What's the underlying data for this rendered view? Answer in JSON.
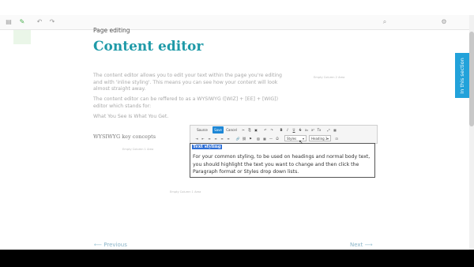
{
  "topbar": {
    "icons": [
      "page-icon",
      "edit-icon",
      "undo-icon",
      "redo-icon",
      "search-icon",
      "settings-icon"
    ]
  },
  "page": {
    "subtitle": "Page editing",
    "title": "Content editor",
    "paragraphs": [
      "The content editor allows you to edit your text within the page you're editing and with 'inline styling'. This means you can see how your content will look almost straight away.",
      "The content editor can be reffered to as a WYSIWYG ([WIZ] + [EE] + [WIG]) editor which stands for:",
      "What You See Is What You Get."
    ],
    "key_heading": "WYSIWYG key concepts",
    "empty_areas": [
      "Empty Column 2 Area",
      "Empty Column 1 Area",
      "Empty Column 1 Area"
    ],
    "side_tab": "In this section"
  },
  "toolbar": {
    "source": "Source",
    "save": "Save",
    "cancel": "Cancel",
    "styles": "Styles",
    "format": "Heading 3",
    "row1_icons": [
      "cut-icon",
      "copy-icon",
      "paste-icon",
      "undo-icon",
      "redo-icon",
      "bold-icon",
      "italic-icon",
      "underline-icon",
      "strike-icon",
      "subscript-icon",
      "superscript-icon",
      "remove-format-icon",
      "maximize-icon",
      "blocks-icon"
    ],
    "row2_icons": [
      "indent-icon",
      "outdent-icon",
      "align-left-icon",
      "align-center-icon",
      "align-right-icon",
      "justify-icon",
      "link-icon",
      "unlink-icon",
      "anchor-icon",
      "image-icon",
      "table-icon",
      "hr-icon",
      "special-char-icon"
    ]
  },
  "editor": {
    "heading": "Text styling",
    "body": "For your common styling, to be used on headings and normal body text, you should highlight the text you want to change and then click the Paragraph format or Styles drop down lists."
  },
  "nav": {
    "previous": "Previous",
    "next": "Next"
  }
}
